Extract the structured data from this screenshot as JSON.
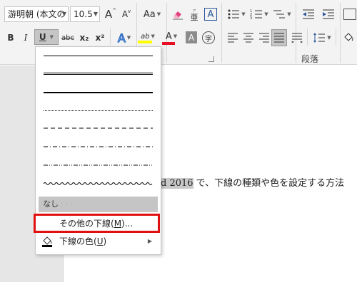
{
  "font": {
    "name": "游明朝 (本文の",
    "size": "10.5"
  },
  "font_buttons": {
    "grow": "A",
    "shrink": "A",
    "case": "Aa",
    "char_border": "A",
    "bold": "B",
    "italic": "I",
    "underline": "U",
    "strike": "abc",
    "subscript": "x₂",
    "superscript": "x²",
    "text_effect": "A",
    "highlight": "ab",
    "font_color": "A",
    "char_shading": "A",
    "enclose": "字"
  },
  "paragraph": {
    "label": "段落"
  },
  "menu": {
    "none_label": "なし",
    "more_underlines": "その他の下線(M)...",
    "underline_color": "下線の色(U)",
    "more_underlines_parts": [
      "その他の下線(",
      "M",
      ")..."
    ],
    "underline_color_parts": [
      "下線の色(",
      "U",
      ")"
    ],
    "grip": "· · · ·"
  },
  "document": {
    "selected_text": "d 2016",
    "rest_text": " で、下線の種類や色を設定する方法"
  },
  "colors": {
    "highlight_yellow": "#ffff00",
    "font_red": "#e81123",
    "callout_red": "#e01010",
    "selection_gray": "#c5c5c5"
  }
}
